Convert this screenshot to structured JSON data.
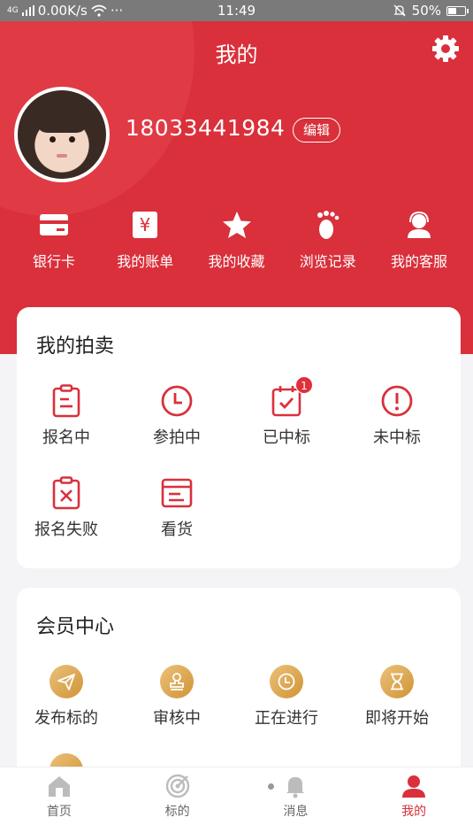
{
  "status_bar": {
    "signal": "4G",
    "speed": "0.00K/s",
    "dots": "···",
    "time": "11:49",
    "battery": "50%",
    "battery_level": 0.5
  },
  "page": {
    "title": "我的"
  },
  "profile": {
    "phone": "18033441984",
    "edit_label": "编辑"
  },
  "quick_links": [
    {
      "label": "银行卡",
      "icon": "bank-card-icon"
    },
    {
      "label": "我的账单",
      "icon": "bill-icon"
    },
    {
      "label": "我的收藏",
      "icon": "star-icon"
    },
    {
      "label": "浏览记录",
      "icon": "footprint-icon"
    },
    {
      "label": "我的客服",
      "icon": "customer-service-icon"
    }
  ],
  "auction": {
    "title": "我的拍卖",
    "items": [
      {
        "label": "报名中",
        "icon": "clipboard-icon"
      },
      {
        "label": "参拍中",
        "icon": "clock-icon"
      },
      {
        "label": "已中标",
        "icon": "calendar-check-icon",
        "badge": "1"
      },
      {
        "label": "未中标",
        "icon": "exclamation-icon"
      },
      {
        "label": "报名失败",
        "icon": "clipboard-x-icon"
      },
      {
        "label": "看货",
        "icon": "box-icon"
      }
    ]
  },
  "member": {
    "title": "会员中心",
    "items": [
      {
        "label": "发布标的",
        "icon": "send-icon"
      },
      {
        "label": "审核中",
        "icon": "stamp-icon"
      },
      {
        "label": "正在进行",
        "icon": "clock-icon"
      },
      {
        "label": "即将开始",
        "icon": "hourglass-icon"
      }
    ]
  },
  "tabbar": [
    {
      "label": "首页",
      "icon": "home-icon",
      "active": false
    },
    {
      "label": "标的",
      "icon": "target-icon",
      "active": false
    },
    {
      "label": "消息",
      "icon": "bell-icon",
      "active": false
    },
    {
      "label": "我的",
      "icon": "user-icon",
      "active": true
    }
  ],
  "colors": {
    "brand_red": "#d9303b",
    "gold": "#d9a24a",
    "background": "#f4f4f6"
  }
}
